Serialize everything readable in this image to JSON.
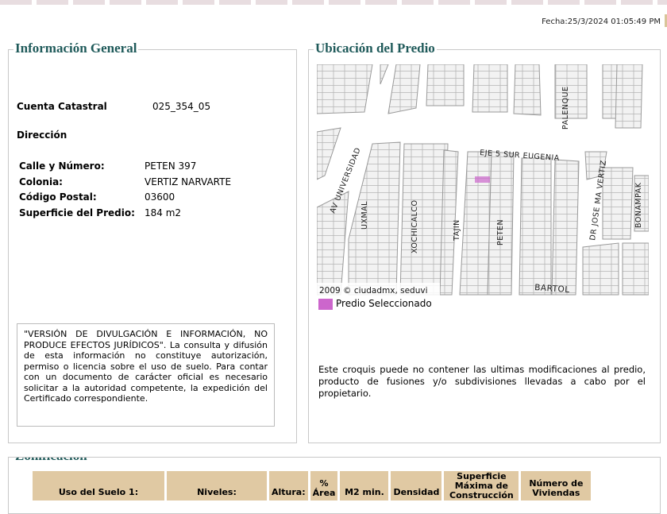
{
  "fecha": "Fecha:25/3/2024 01:05:49 PM",
  "info": {
    "title": "Información General",
    "cuenta_label": "Cuenta Catastral",
    "cuenta_value": "025_354_05",
    "direccion_label": "Dirección",
    "fields": [
      {
        "label": "Calle y Número:",
        "value": "PETEN 397"
      },
      {
        "label": "Colonia:",
        "value": "VERTIZ NARVARTE"
      },
      {
        "label": "Código Postal:",
        "value": "03600"
      },
      {
        "label": "Superficie del Predio:",
        "value": "184 m2"
      }
    ],
    "disclaimer": "\"VERSIÓN DE DIVULGACIÓN E INFORMACIÓN, NO PRODUCE EFECTOS JURÍDICOS\". La consulta y difusión de esta información no constituye autorización, permiso o licencia sobre el uso de suelo. Para contar con un documento de carácter oficial es necesario solicitar a la autoridad competente, la expedición del Certificado correspondiente."
  },
  "ubicacion": {
    "title": "Ubicación del Predio",
    "streets": [
      "AV UNIVERSIDAD",
      "UXMAL",
      "XOCHICALCO",
      "TAJIN",
      "PETEN",
      "EJE 5 SUR EUGENIA",
      "PALENQUE",
      "DR JOSE MA VERTIZ",
      "BONAMPAK",
      "BARTOL"
    ],
    "copyright": "2009 © ciudadmx, seduvi",
    "legend": "Predio Seleccionado",
    "legend_color": "#cc66cc",
    "note": "Este croquis puede no contener las ultimas modificaciones al predio, producto de fusiones y/o subdivisiones llevadas a cabo por el propietario."
  },
  "zonificacion": {
    "title": "Zonificación",
    "headers": [
      "Uso del Suelo 1:",
      "Niveles:",
      "Altura:",
      "% Área",
      "M2 min.",
      "Densidad",
      "Superficie Máxima de Construcción",
      "Número de Viviendas"
    ]
  }
}
